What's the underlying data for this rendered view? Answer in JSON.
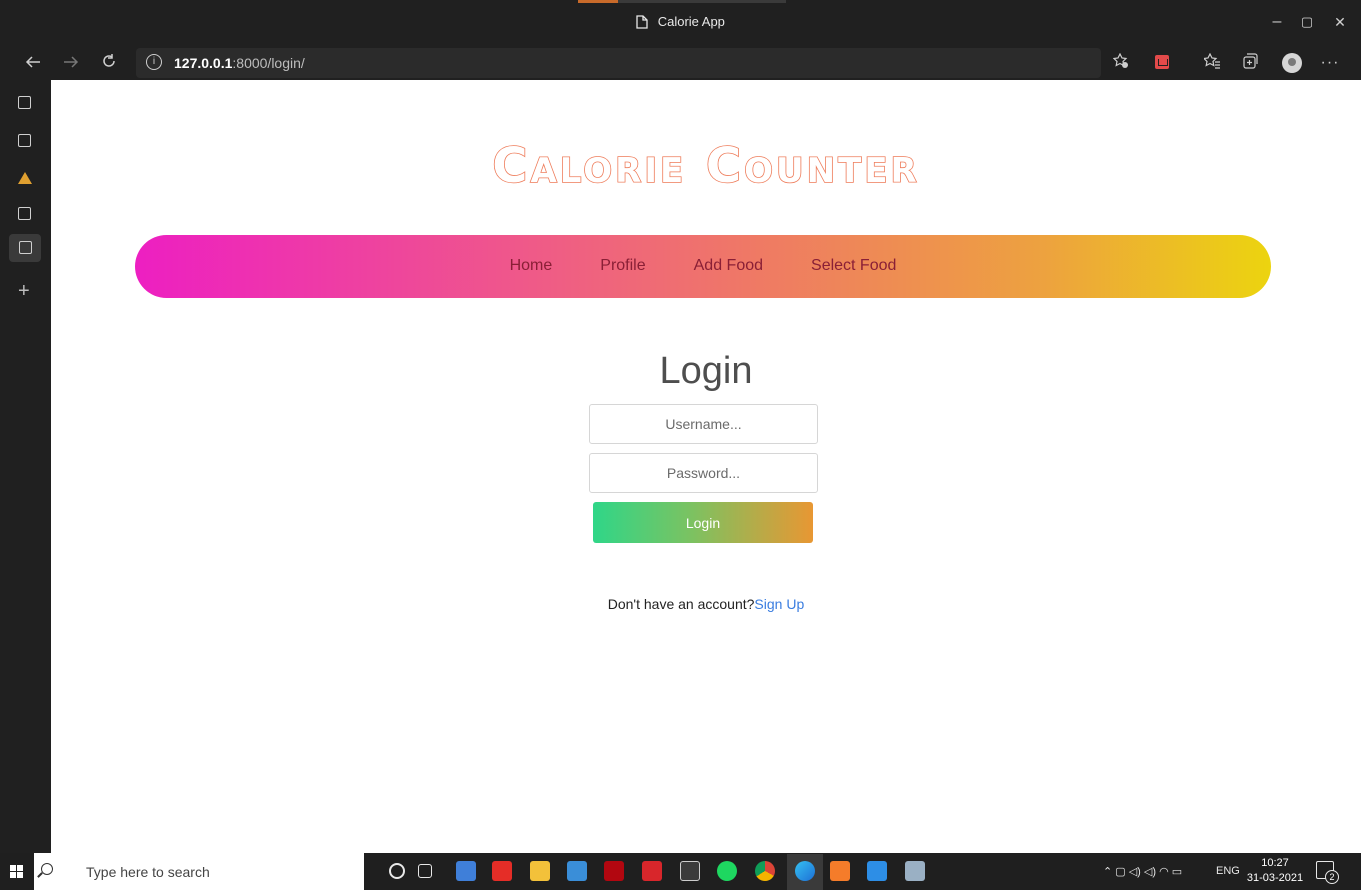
{
  "browser": {
    "window_title": "Calorie App",
    "url_host": "127.0.0.1",
    "url_path": ":8000/login/",
    "window_controls": {
      "minimize": "–",
      "maximize": "▢",
      "close": "✕"
    },
    "nav_icons": [
      "back-arrow-icon",
      "forward-arrow-icon",
      "refresh-icon",
      "site-info-icon"
    ],
    "toolbar_icons": [
      "favorites-add-icon",
      "save-to-pocket-icon",
      "favorites-icon",
      "collections-icon",
      "profile-icon",
      "more-menu-icon"
    ]
  },
  "vertical_tabs": {
    "icons": [
      "tab-icon",
      "tab-icon",
      "mountain-logo-icon",
      "tab-icon",
      "document-icon"
    ],
    "new_tab_label": "+"
  },
  "page": {
    "logo_text": "Calorie Counter",
    "nav": {
      "items": [
        "Home",
        "Profile",
        "Add Food",
        "Select Food"
      ]
    },
    "login": {
      "title": "Login",
      "username_placeholder": "Username...",
      "password_placeholder": "Password...",
      "submit_label": "Login",
      "signup_prompt": "Don't have an account?",
      "signup_link": "Sign Up"
    },
    "colors": {
      "nav_gradient_start": "#ed1fc2",
      "nav_gradient_end": "#ecd40f",
      "logo_outline": "#ee7b59",
      "button_gradient_start": "#2fd688",
      "button_gradient_end": "#e89733",
      "link": "#3a7de0"
    }
  },
  "taskbar": {
    "search_placeholder": "Type here to search",
    "tray_lang": "ENG",
    "time": "10:27",
    "date": "31-03-2021",
    "notification_count": "2",
    "apps": [
      "cortana-icon",
      "task-view-icon",
      "vpn-icon",
      "youtube-icon",
      "file-explorer-icon",
      "mail-icon",
      "netflix-icon",
      "acrobat-icon",
      "epic-games-icon",
      "spotify-icon",
      "chrome-icon",
      "edge-icon",
      "xampp-icon",
      "vscode-icon",
      "snip-tool-icon"
    ]
  }
}
